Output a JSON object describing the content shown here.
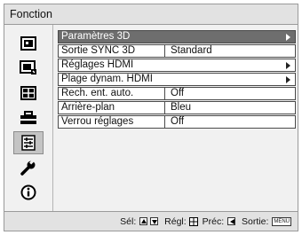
{
  "window": {
    "title": "Fonction"
  },
  "sidebar": {
    "items": [
      {
        "icon": "picture-icon",
        "active": false
      },
      {
        "icon": "screen-adjust-icon",
        "active": false
      },
      {
        "icon": "input-setup-icon",
        "active": false
      },
      {
        "icon": "toolbox-icon",
        "active": false
      },
      {
        "icon": "function-menu-icon",
        "active": true
      },
      {
        "icon": "wrench-icon",
        "active": false
      },
      {
        "icon": "info-icon",
        "active": false
      }
    ]
  },
  "menu": {
    "rows": [
      {
        "label": "Paramètres 3D",
        "value": "",
        "submenu": true,
        "selected": true
      },
      {
        "label": "Sortie SYNC 3D",
        "value": "Standard",
        "submenu": false,
        "selected": false
      },
      {
        "label": "Réglages HDMI",
        "value": "",
        "submenu": true,
        "selected": false
      },
      {
        "label": "Plage dynam. HDMI",
        "value": "",
        "submenu": true,
        "selected": false
      },
      {
        "label": "Rech. ent. auto.",
        "value": "Off",
        "submenu": false,
        "selected": false
      },
      {
        "label": "Arrière-plan",
        "value": "Bleu",
        "submenu": false,
        "selected": false
      },
      {
        "label": "Verrou réglages",
        "value": "Off",
        "submenu": false,
        "selected": false
      }
    ]
  },
  "footer": {
    "select_label": "Sél:",
    "adjust_label": "Régl:",
    "back_label": "Préc:",
    "exit_label": "Sortie:",
    "menu_key": "MENU"
  },
  "colors": {
    "selected_row": "#6e6e6e",
    "title_bar": "#e2e2e2",
    "panel_bg": "#f1f1f1"
  }
}
